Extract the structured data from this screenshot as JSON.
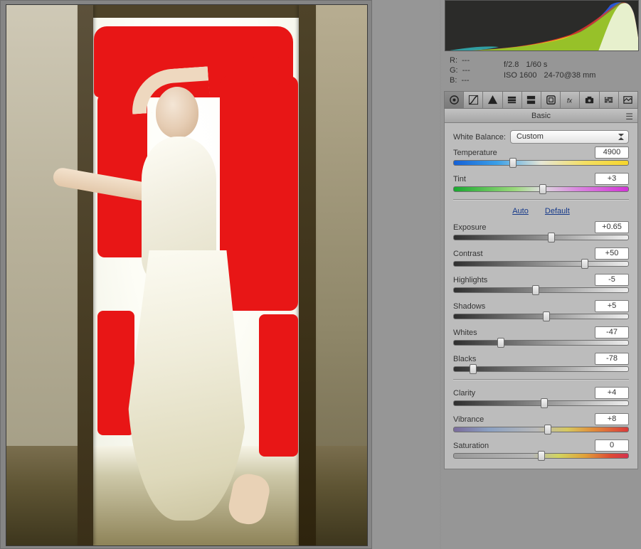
{
  "info": {
    "r_label": "R:",
    "g_label": "G:",
    "b_label": "B:",
    "r": "---",
    "g": "---",
    "b": "---",
    "aperture": "f/2.8",
    "shutter": "1/60 s",
    "iso": "ISO 1600",
    "lens": "24-70@38 mm"
  },
  "panel_tabs": [
    "basic",
    "curve",
    "detail",
    "hsl",
    "split",
    "lens",
    "fx",
    "camera",
    "presets",
    "snapshot"
  ],
  "panel_title": "Basic",
  "white_balance": {
    "label": "White Balance:",
    "value": "Custom"
  },
  "links": {
    "auto": "Auto",
    "default": "Default"
  },
  "sliders": {
    "temperature": {
      "label": "Temperature",
      "value": "4900",
      "pos": 34
    },
    "tint": {
      "label": "Tint",
      "value": "+3",
      "pos": 51
    },
    "exposure": {
      "label": "Exposure",
      "value": "+0.65",
      "pos": 56
    },
    "contrast": {
      "label": "Contrast",
      "value": "+50",
      "pos": 75
    },
    "highlights": {
      "label": "Highlights",
      "value": "-5",
      "pos": 47
    },
    "shadows": {
      "label": "Shadows",
      "value": "+5",
      "pos": 53
    },
    "whites": {
      "label": "Whites",
      "value": "-47",
      "pos": 27
    },
    "blacks": {
      "label": "Blacks",
      "value": "-78",
      "pos": 11
    },
    "clarity": {
      "label": "Clarity",
      "value": "+4",
      "pos": 52
    },
    "vibrance": {
      "label": "Vibrance",
      "value": "+8",
      "pos": 54
    },
    "saturation": {
      "label": "Saturation",
      "value": "0",
      "pos": 50
    }
  }
}
